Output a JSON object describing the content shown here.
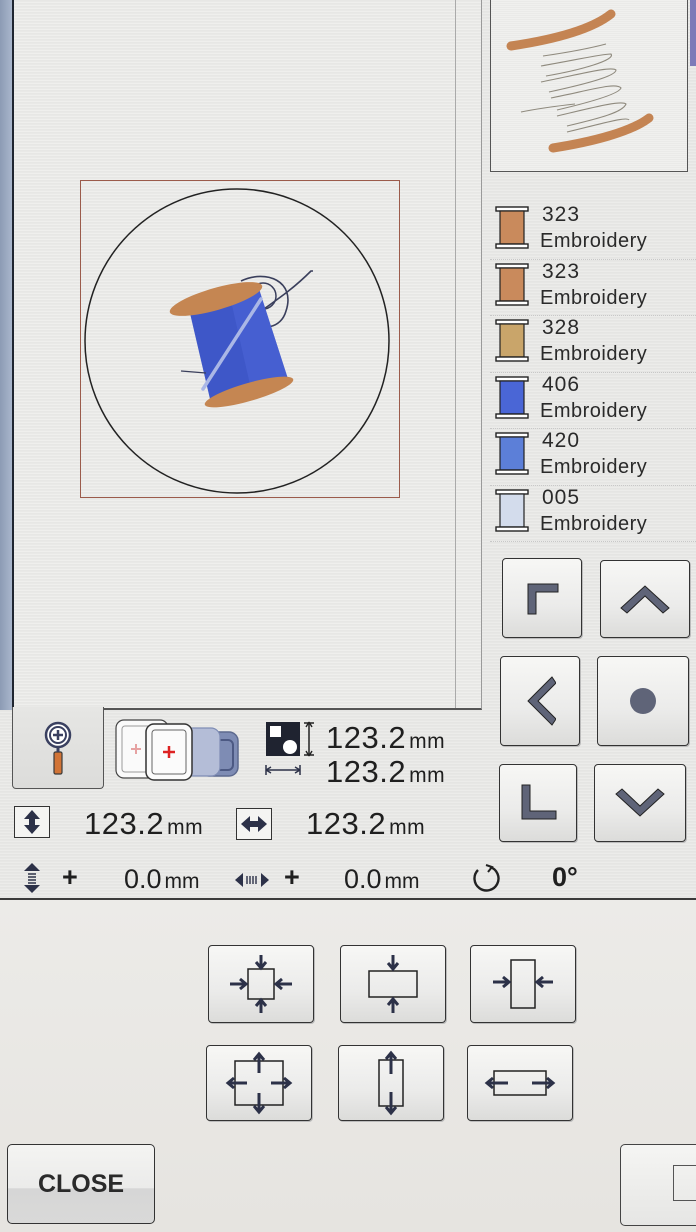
{
  "canvas": {
    "design_name": "thread-spool-embroidery",
    "frame_color": "#9b5b4b",
    "circle_color": "#222222"
  },
  "thread_list": [
    {
      "code": "323",
      "name": "Embroidery",
      "color": "#c98a5c"
    },
    {
      "code": "323",
      "name": "Embroidery",
      "color": "#c98a5c"
    },
    {
      "code": "328",
      "name": "Embroidery",
      "color": "#c9a56a"
    },
    {
      "code": "406",
      "name": "Embroidery",
      "color": "#4a66d6"
    },
    {
      "code": "420",
      "name": "Embroidery",
      "color": "#5c7fd8"
    },
    {
      "code": "005",
      "name": "Embroidery",
      "color": "#d3dcec"
    }
  ],
  "pattern_size": {
    "height": "123.2",
    "width": "123.2",
    "unit": "mm"
  },
  "size_readout": {
    "height_value": "123.2",
    "width_value": "123.2",
    "unit": "mm"
  },
  "position_readout": {
    "vertical_sign": "+",
    "vertical_value": "0.0",
    "horizontal_sign": "+",
    "horizontal_value": "0.0",
    "unit": "mm",
    "rotation_value": "0°"
  },
  "icons": {
    "zoom": "magnifier-plus-icon",
    "hoop": "hoop-selection-icon",
    "pattern_size": "pattern-size-icon",
    "height": "vertical-arrows-icon",
    "width": "horizontal-arrows-icon",
    "rotation": "rotate-icon"
  },
  "footer": {
    "close_label": "CLOSE"
  },
  "accent_colors": {
    "icon_fill": "#5f6478",
    "arrow_fill": "#2c3148"
  }
}
